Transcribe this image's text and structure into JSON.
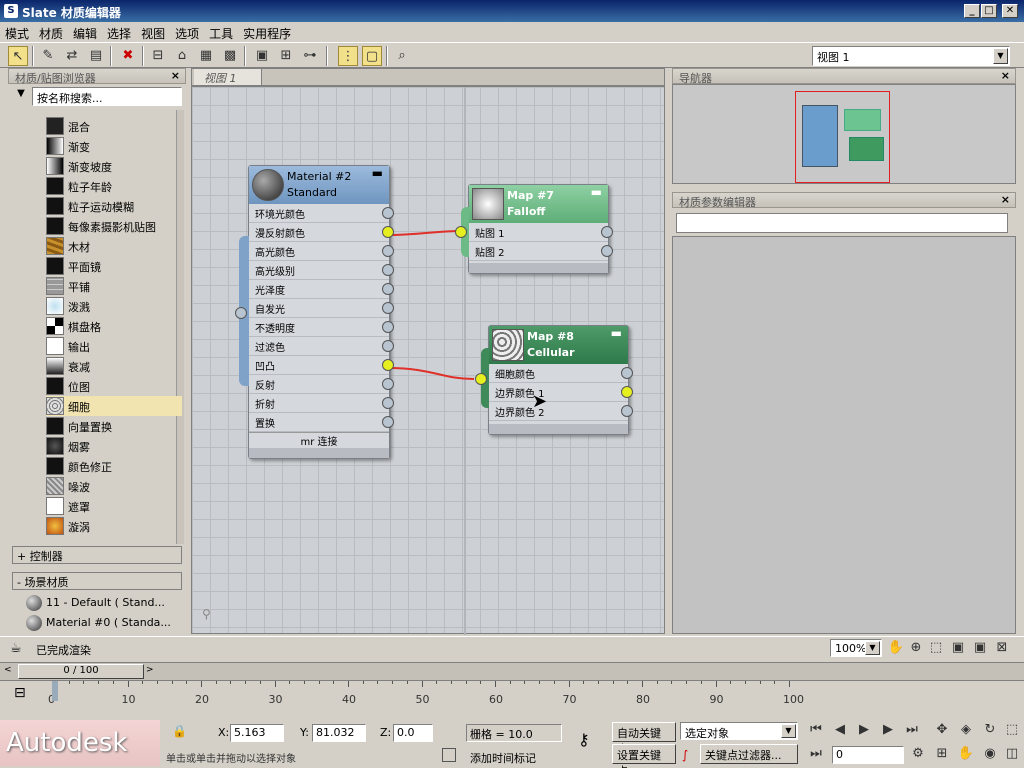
{
  "window": {
    "title": "Slate 材质编辑器"
  },
  "menu": [
    "模式",
    "材质",
    "编辑",
    "选择",
    "视图",
    "选项",
    "工具",
    "实用程序"
  ],
  "toolbar": {
    "view_select": "视图 1"
  },
  "browser": {
    "title": "材质/贴图浏览器",
    "search_placeholder": "按名称搜索...",
    "items": [
      {
        "label": "混合",
        "icon": "blend-swatch-icon"
      },
      {
        "label": "渐变",
        "icon": "gradient-swatch-icon"
      },
      {
        "label": "渐变坡度",
        "icon": "gradient-ramp-swatch-icon"
      },
      {
        "label": "粒子年龄",
        "icon": "particle-age-swatch-icon"
      },
      {
        "label": "粒子运动模糊",
        "icon": "particle-mblur-swatch-icon"
      },
      {
        "label": "每像素摄影机贴图",
        "icon": "camera-map-swatch-icon"
      },
      {
        "label": "木材",
        "icon": "wood-swatch-icon"
      },
      {
        "label": "平面镜",
        "icon": "flat-mirror-swatch-icon"
      },
      {
        "label": "平铺",
        "icon": "tiles-swatch-icon"
      },
      {
        "label": "泼溅",
        "icon": "splat-swatch-icon"
      },
      {
        "label": "棋盘格",
        "icon": "checker-swatch-icon"
      },
      {
        "label": "输出",
        "icon": "output-swatch-icon"
      },
      {
        "label": "衰减",
        "icon": "falloff-swatch-icon"
      },
      {
        "label": "位图",
        "icon": "bitmap-swatch-icon"
      },
      {
        "label": "细胞",
        "icon": "cellular-swatch-icon"
      },
      {
        "label": "向量置换",
        "icon": "vector-disp-swatch-icon"
      },
      {
        "label": "烟雾",
        "icon": "smoke-swatch-icon"
      },
      {
        "label": "颜色修正",
        "icon": "color-correct-swatch-icon"
      },
      {
        "label": "噪波",
        "icon": "noise-swatch-icon"
      },
      {
        "label": "遮罩",
        "icon": "mask-swatch-icon"
      },
      {
        "label": "漩涡",
        "icon": "swirl-swatch-icon"
      }
    ],
    "controllers": "+ 控制器",
    "scene_materials": "- 场景材质",
    "scene_items": [
      "11 - Default  ( Stand...",
      "Material #0  ( Standa..."
    ]
  },
  "view_tab": "视图 1",
  "nodes": {
    "material": {
      "title": "Material #2",
      "subtitle": "Standard",
      "slots": [
        "环境光颜色",
        "漫反射颜色",
        "高光颜色",
        "高光级别",
        "光泽度",
        "自发光",
        "不透明度",
        "过滤色",
        "凹凸",
        "反射",
        "折射",
        "置换"
      ],
      "footer": "mr 连接"
    },
    "falloff": {
      "title": "Map #7",
      "subtitle": "Falloff",
      "slots": [
        "贴图 1",
        "贴图 2"
      ]
    },
    "cellular": {
      "title": "Map #8",
      "subtitle": "Cellular",
      "slots": [
        "细胞颜色",
        "边界颜色 1",
        "边界颜色 2"
      ]
    }
  },
  "navigator": {
    "title": "导航器"
  },
  "param_editor": {
    "title": "材质参数编辑器"
  },
  "status": {
    "render_text": "已完成渲染",
    "zoom": "100%"
  },
  "timeline": {
    "frame": "0 / 100",
    "ticks": [
      "0",
      "10",
      "20",
      "30",
      "40",
      "50",
      "60",
      "70",
      "80",
      "90",
      "100"
    ]
  },
  "bottom": {
    "brand": "Autodesk",
    "x_label": "X:",
    "x_value": "5.163",
    "y_label": "Y:",
    "y_value": "81.032",
    "z_label": "Z:",
    "z_value": "0.0",
    "grid": "栅格 = 10.0",
    "auto_key": "自动关键点",
    "set_key": "设置关键点",
    "selected_object": "选定对象",
    "key_filters": "关键点过滤器...",
    "add_time_tag": "添加时间标记",
    "prompt": "单击或单击并拖动以选择对象",
    "frame_value": "0"
  },
  "colors": {
    "material_header": "#7ea2c8",
    "falloff_header": "#6cba86",
    "cellular_header": "#3e8a58",
    "wire": "#e0302a",
    "socket_active": "#e6f020"
  }
}
